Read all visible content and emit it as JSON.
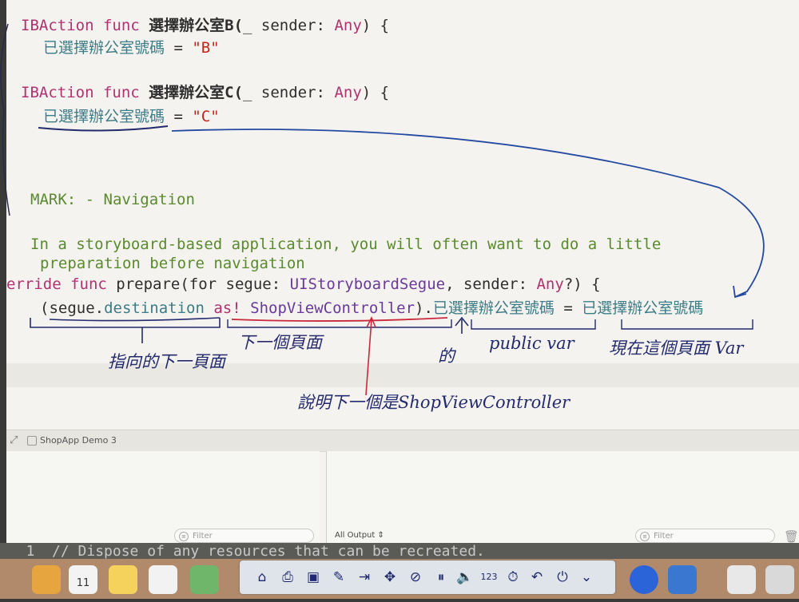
{
  "code": {
    "line1": {
      "lead": "IBAction func ",
      "name": "選擇辦公室B(",
      "label": "_ sender: ",
      "type": "Any",
      "tail": ") {"
    },
    "line2": {
      "prop": "已選擇辦公室號碼",
      "eq": " = ",
      "str": "\"B\""
    },
    "line3": {
      "lead": "IBAction func ",
      "name": "選擇辦公室C(",
      "label": "_ sender: ",
      "type": "Any",
      "tail": ") {"
    },
    "line4": {
      "prop": "已選擇辦公室號碼",
      "eq": " = ",
      "str": "\"C\""
    },
    "line5": {
      "text": "MARK: - Navigation"
    },
    "line6": {
      "text": "In a storyboard-based application, you will often want to do a little"
    },
    "line7": {
      "text": "preparation before navigation"
    },
    "line8": {
      "lead": "erride func ",
      "name": "prepare(for segue: ",
      "type": "UIStoryboardSegue",
      "mid": ", sender: ",
      "type2": "Any",
      "tail": "?) {"
    },
    "line9": {
      "open": "(segue.",
      "dest": "destination",
      "as": " as! ",
      "cls": "ShopViewController",
      "close": ").",
      "prop": "已選擇辦公室號碼",
      "eq": " = ",
      "prop2": "已選擇辦公室號碼"
    }
  },
  "debug": {
    "scheme_name": "ShopApp Demo 3",
    "variables_filter_placeholder": "Filter",
    "console_output_select": "All Output",
    "console_filter_placeholder": "Filter"
  },
  "background_strip": "   1  // Dispose of any resources that can be recreated.",
  "dock": {
    "calendar_day": "11"
  },
  "touchbar_icons": [
    "home-icon",
    "print-icon",
    "save-icon",
    "edit-icon",
    "import-icon",
    "move-icon",
    "no-bluetooth-icon",
    "pause-icon",
    "volume-icon",
    "numbers-icon",
    "timer-icon",
    "undo-icon",
    "power-icon",
    "chevron-down-icon"
  ],
  "annotations": {
    "a1": "指向的下一頁面",
    "a2": "下一個頁面",
    "a3": "的",
    "a4": "public var",
    "a5": "現在這個頁面 Var",
    "a6": "說明下一個是ShopViewController"
  },
  "colors": {
    "keyword": "#b0326f",
    "string": "#c4241a",
    "property": "#3c7c86",
    "comment": "#5a8a2e",
    "ink": "#232a6e"
  }
}
